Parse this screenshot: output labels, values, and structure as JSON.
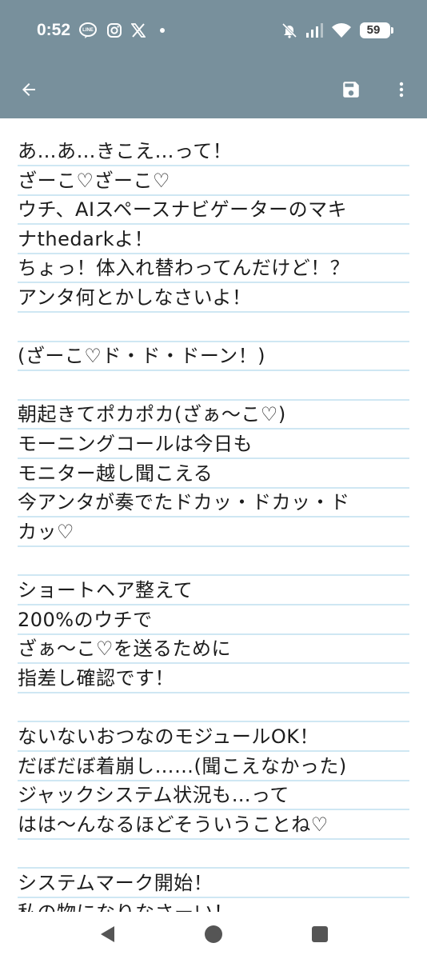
{
  "status_bar": {
    "time": "0:52",
    "line_icon_text": "LINE",
    "battery_level": "59",
    "icons": [
      "line-icon",
      "instagram-icon",
      "x-icon",
      "dot-icon",
      "mute-icon",
      "signal-icon",
      "wifi-icon",
      "battery-icon"
    ]
  },
  "app_bar": {
    "back_icon": "arrow-back-icon",
    "save_icon": "save-icon",
    "menu_icon": "more-vert-icon",
    "background_color": "#78909c"
  },
  "editor": {
    "rule_color": "#cfe7f3",
    "lines": [
      "あ…あ…きこえ…って！",
      "ざーこ♡ざーこ♡",
      "ウチ、AIスペースナビゲーターのマキ",
      "ナthedarkよ！",
      "ちょっ！体入れ替わってんだけど！？",
      "アンタ何とかしなさいよ！",
      "",
      "(ざーこ♡ド・ド・ドーン！)",
      "",
      "朝起きてポカポカ(ざぁ〜こ♡)",
      "モーニングコールは今日も",
      "モニター越し聞こえる",
      "今アンタが奏でたドカッ・ドカッ・ド",
      "カッ♡",
      "",
      "ショートヘア整えて",
      "200%のウチで",
      "ざぁ〜こ♡を送るために",
      "指差し確認です！",
      "",
      "ないないおつなのモジュールOK！",
      "だぼだぼ着崩し……(聞こえなかった)",
      "ジャックシステム状況も…って",
      "はは〜んなるほどそういうことね♡",
      "",
      "システムマーク開始！",
      "私の物になりなさーい！"
    ]
  },
  "nav_bar": {
    "back_icon": "nav-back-icon",
    "home_icon": "nav-home-icon",
    "recents_icon": "nav-recents-icon"
  }
}
